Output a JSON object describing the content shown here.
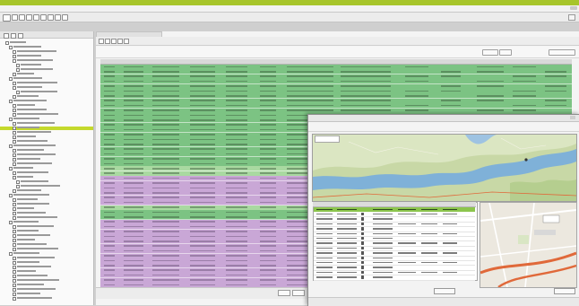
{
  "colors": {
    "accent_bar": "#a7c52b",
    "tree_selection": "#c4d92c",
    "row_green": "#7cc383",
    "row_light_green": "#a9d9a1",
    "row_purple": "#c9a7d6",
    "popup_selection": "#8cc54d",
    "map_land": "#c8d8a6",
    "map_water": "#7fb1d8",
    "map_road": "#e0693a"
  },
  "icons": {
    "toolbar": [
      "new-icon",
      "open-icon",
      "save-icon",
      "print-icon",
      "cut-icon",
      "copy-icon",
      "paste-icon",
      "refresh-icon",
      "settings-icon"
    ],
    "map": [
      "map-marker-icon"
    ],
    "popup": [
      "close-icon"
    ]
  },
  "grid": {
    "row_colors": [
      "green",
      "green",
      "green",
      "green",
      "green",
      "green",
      "green",
      "green",
      "green",
      "green",
      "green",
      "green",
      "green",
      "green",
      "green",
      "green",
      "green",
      "green",
      "green",
      "green",
      "green",
      "lgreen",
      "lgreen",
      "purple",
      "purple",
      "purple",
      "purple",
      "purple",
      "purple",
      "lgreen",
      "green",
      "green",
      "purple",
      "purple",
      "purple",
      "purple",
      "purple",
      "purple",
      "purple",
      "purple",
      "purple",
      "purple",
      "purple",
      "purple",
      "purple",
      "purple"
    ]
  },
  "popup_grid": {
    "check_column": [
      false,
      true,
      true,
      true,
      true,
      true,
      true,
      true,
      true,
      true,
      true,
      true,
      true,
      true,
      true
    ]
  }
}
